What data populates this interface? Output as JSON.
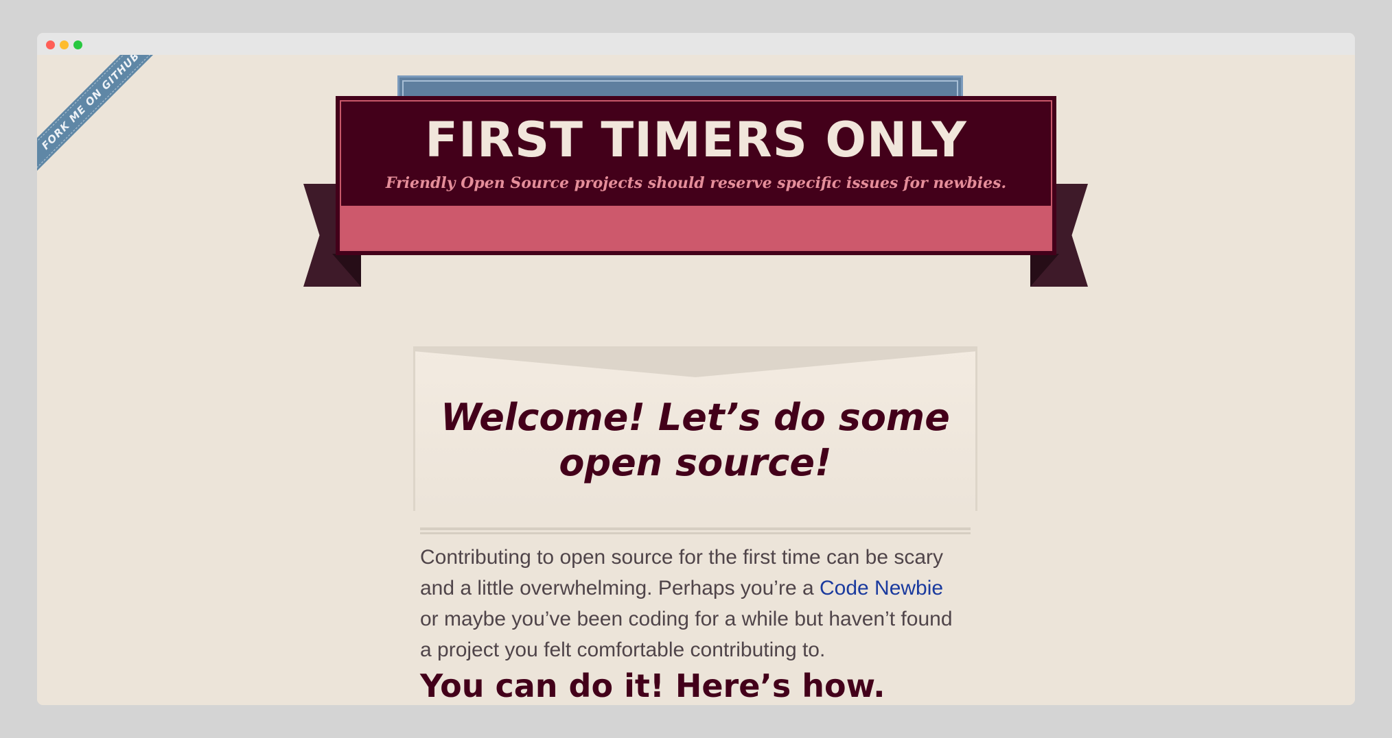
{
  "ribbon": {
    "label": "FORK ME ON GITHUB"
  },
  "banner": {
    "title": "FIRST TIMERS ONLY",
    "subtitle": "Friendly Open Source projects should reserve specific issues for newbies."
  },
  "welcome": {
    "heading": "Welcome! Let’s do some open source!"
  },
  "intro": {
    "before": "Contributing to open source for the first time can be scary and a little overwhelming. Perhaps you’re a ",
    "link": "Code Newbie",
    "after": " or maybe you’ve been coding for a while but haven’t found a project you felt comfortable contributing to."
  },
  "section": {
    "heading": "You can do it! Here’s how."
  },
  "colors": {
    "background": "#ece4d9",
    "maroon": "#43001a",
    "rose": "#cd596c",
    "ribbon_blue": "#5f87a6",
    "link": "#1a3a9e"
  }
}
